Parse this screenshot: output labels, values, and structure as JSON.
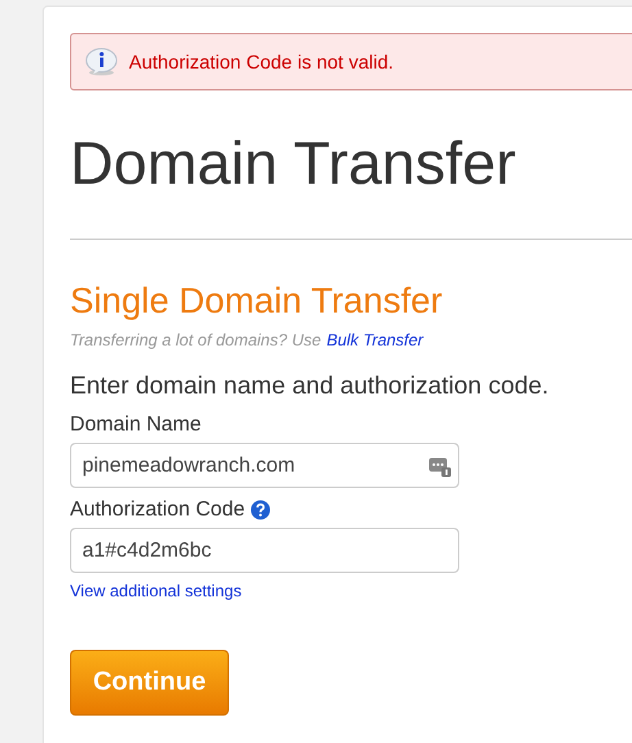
{
  "alert": {
    "kind": "error",
    "message": "Authorization Code is not valid."
  },
  "title": "Domain Transfer",
  "section": {
    "heading": "Single Domain Transfer",
    "hint": "Transferring a lot of domains? Use",
    "hint_link": "Bulk Transfer",
    "instruction": "Enter domain name and authorization code."
  },
  "fields": [
    {
      "label": "Domain Name",
      "value": "pinemeadowranch.com",
      "help": false,
      "autofill": true
    },
    {
      "label": "Authorization Code",
      "value": "a1#c4d2m6bc",
      "help": true,
      "autofill": false
    }
  ],
  "settings_link": "View additional settings",
  "buttons": [
    "Continue"
  ]
}
